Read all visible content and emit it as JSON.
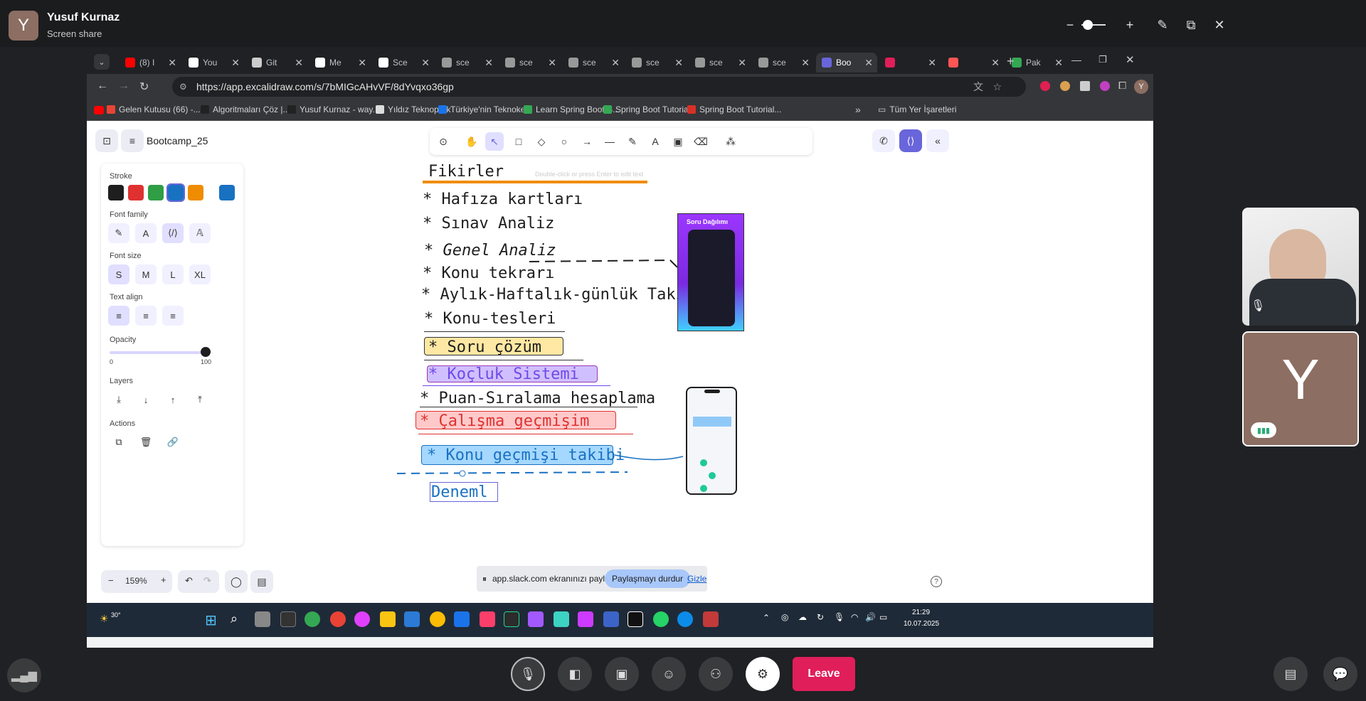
{
  "slack": {
    "avatar_letter": "Y",
    "user_name": "Yusuf Kurnaz",
    "subtitle": "Screen share",
    "leave_label": "Leave",
    "participant_letter": "Y"
  },
  "browser": {
    "tabs": [
      {
        "label": "(8) I",
        "color": "#ff0000"
      },
      {
        "label": "You",
        "color": "#ffffff"
      },
      {
        "label": "Git",
        "color": "#cccccc"
      },
      {
        "label": "Me",
        "color": "#ffffff"
      },
      {
        "label": "Sce",
        "color": "#ffffff"
      },
      {
        "label": "sce",
        "color": "#999999"
      },
      {
        "label": "sce",
        "color": "#999999"
      },
      {
        "label": "sce",
        "color": "#999999"
      },
      {
        "label": "sce",
        "color": "#999999"
      },
      {
        "label": "sce",
        "color": "#999999"
      },
      {
        "label": "sce",
        "color": "#999999"
      },
      {
        "label": "Boo",
        "color": "#6965db"
      },
      {
        "label": "",
        "color": "#e01e5a"
      },
      {
        "label": "",
        "color": "#ff5555"
      },
      {
        "label": "Pak",
        "color": "#34a853"
      }
    ],
    "url": "https://app.excalidraw.com/s/7bMIGcAHvVF/8dYvqxo36gp",
    "bookmarks": [
      {
        "label": "Gelen Kutusu (66) -...",
        "color": "#ea4335"
      },
      {
        "label": "Algoritmaları Çöz |...",
        "color": "#222222"
      },
      {
        "label": "Yusuf Kurnaz - way...",
        "color": "#222222"
      },
      {
        "label": "Yıldız Teknopark",
        "color": "#dddddd"
      },
      {
        "label": "Türkiye'nin Teknoke...",
        "color": "#1a73e8"
      },
      {
        "label": "Learn Spring Boot S...",
        "color": "#34a853"
      },
      {
        "label": "Spring Boot Tutorial",
        "color": "#34a853"
      },
      {
        "label": "Spring Boot Tutorial...",
        "color": "#d93025"
      }
    ],
    "all_bookmarks": "Tüm Yer İşaretleri"
  },
  "excalidraw": {
    "file_name": "Bootcamp_25",
    "hint": "Double-click or press Enter to edit text",
    "props": {
      "stroke": "Stroke",
      "font_family": "Font family",
      "font_size": "Font size",
      "sizes": [
        "S",
        "M",
        "L",
        "XL"
      ],
      "text_align": "Text align",
      "opacity": "Opacity",
      "opacity_min": "0",
      "opacity_max": "100",
      "layers": "Layers",
      "actions": "Actions"
    },
    "stroke_colors": [
      "#1e1e1e",
      "#e03131",
      "#2f9e44",
      "#1971c2",
      "#f08c00",
      "#1971c2"
    ],
    "zoom": "159%",
    "heading": "Fikirler",
    "items": [
      "* Hafıza kartları",
      "* Sınav Analiz",
      "* Genel Analiz",
      "* Konu tekrarı",
      "* Aylık-Haftalık-günlük Takip",
      "* Konu-tesleri",
      "* Soru çözüm",
      "* Koçluk Sistemi",
      "* Puan-Sıralama hesaplama",
      "* Çalışma geçmişim",
      "* Konu geçmişi takibi",
      "Deneml"
    ],
    "phone_title": "Soru Dağılımı"
  },
  "share_banner": {
    "text": "app.slack.com ekranınızı paylaşıyor.",
    "stop": "Paylaşmayı durdur",
    "hide": "Gizle"
  },
  "taskbar": {
    "temp": "30°",
    "time": "21:29",
    "date": "10.07.2025"
  }
}
